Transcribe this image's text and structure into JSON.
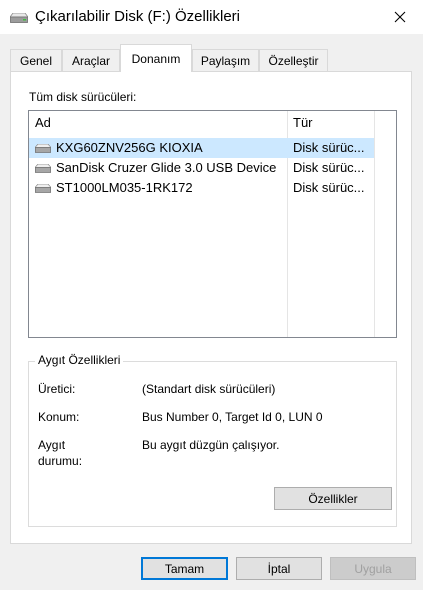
{
  "window": {
    "title": "Çıkarılabilir Disk (F:) Özellikleri",
    "title_icon": "drive-icon",
    "close_icon": "close-icon"
  },
  "tabs": [
    {
      "label": "Genel",
      "active": false
    },
    {
      "label": "Araçlar",
      "active": false
    },
    {
      "label": "Donanım",
      "active": true
    },
    {
      "label": "Paylaşım",
      "active": false
    },
    {
      "label": "Özelleştir",
      "active": false
    }
  ],
  "hardware": {
    "list_label": "Tüm disk sürücüleri:",
    "columns": {
      "name": "Ad",
      "type": "Tür"
    },
    "rows": [
      {
        "name": "KXG60ZNV256G KIOXIA",
        "type": "Disk sürüc...",
        "selected": true,
        "icon": "disk-drive-icon"
      },
      {
        "name": "SanDisk Cruzer Glide 3.0 USB Device",
        "type": "Disk sürüc...",
        "selected": false,
        "icon": "disk-drive-icon"
      },
      {
        "name": "ST1000LM035-1RK172",
        "type": "Disk sürüc...",
        "selected": false,
        "icon": "disk-drive-icon"
      }
    ],
    "properties": {
      "title": "Aygıt Özellikleri",
      "manufacturer_label": "Üretici:",
      "manufacturer_value": "(Standart disk sürücüleri)",
      "location_label": "Konum:",
      "location_value": "Bus Number 0, Target Id 0, LUN 0",
      "status_label_line1": "Aygıt",
      "status_label_line2": "durumu:",
      "status_value": "Bu aygıt düzgün çalışıyor.",
      "properties_button": "Özellikler"
    }
  },
  "footer": {
    "ok": "Tamam",
    "cancel": "İptal",
    "apply": "Uygula",
    "apply_enabled": false
  },
  "colors": {
    "selection": "#cce8ff",
    "default_button_border": "#0078d7"
  }
}
